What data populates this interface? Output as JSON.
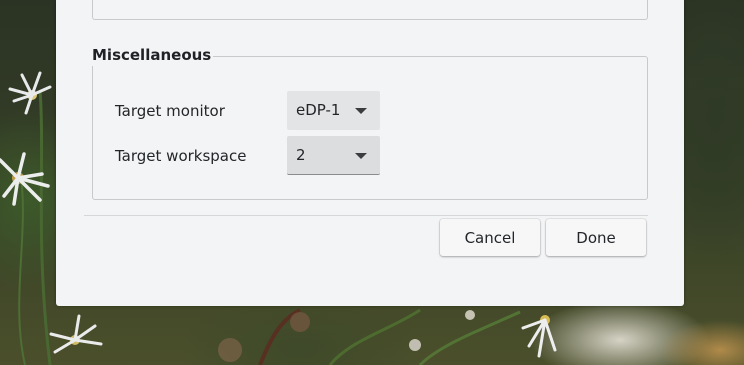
{
  "misc_group": {
    "title": "Miscellaneous",
    "rows": [
      {
        "label": "Target monitor",
        "value": "eDP-1"
      },
      {
        "label": "Target workspace",
        "value": "2"
      }
    ]
  },
  "buttons": {
    "cancel": "Cancel",
    "done": "Done"
  },
  "icons": {
    "combo_arrow": "chevron-down-icon"
  },
  "colors": {
    "dialog_bg": "#f3f4f6",
    "frame_border": "#c8c9cb",
    "text": "#232629"
  }
}
